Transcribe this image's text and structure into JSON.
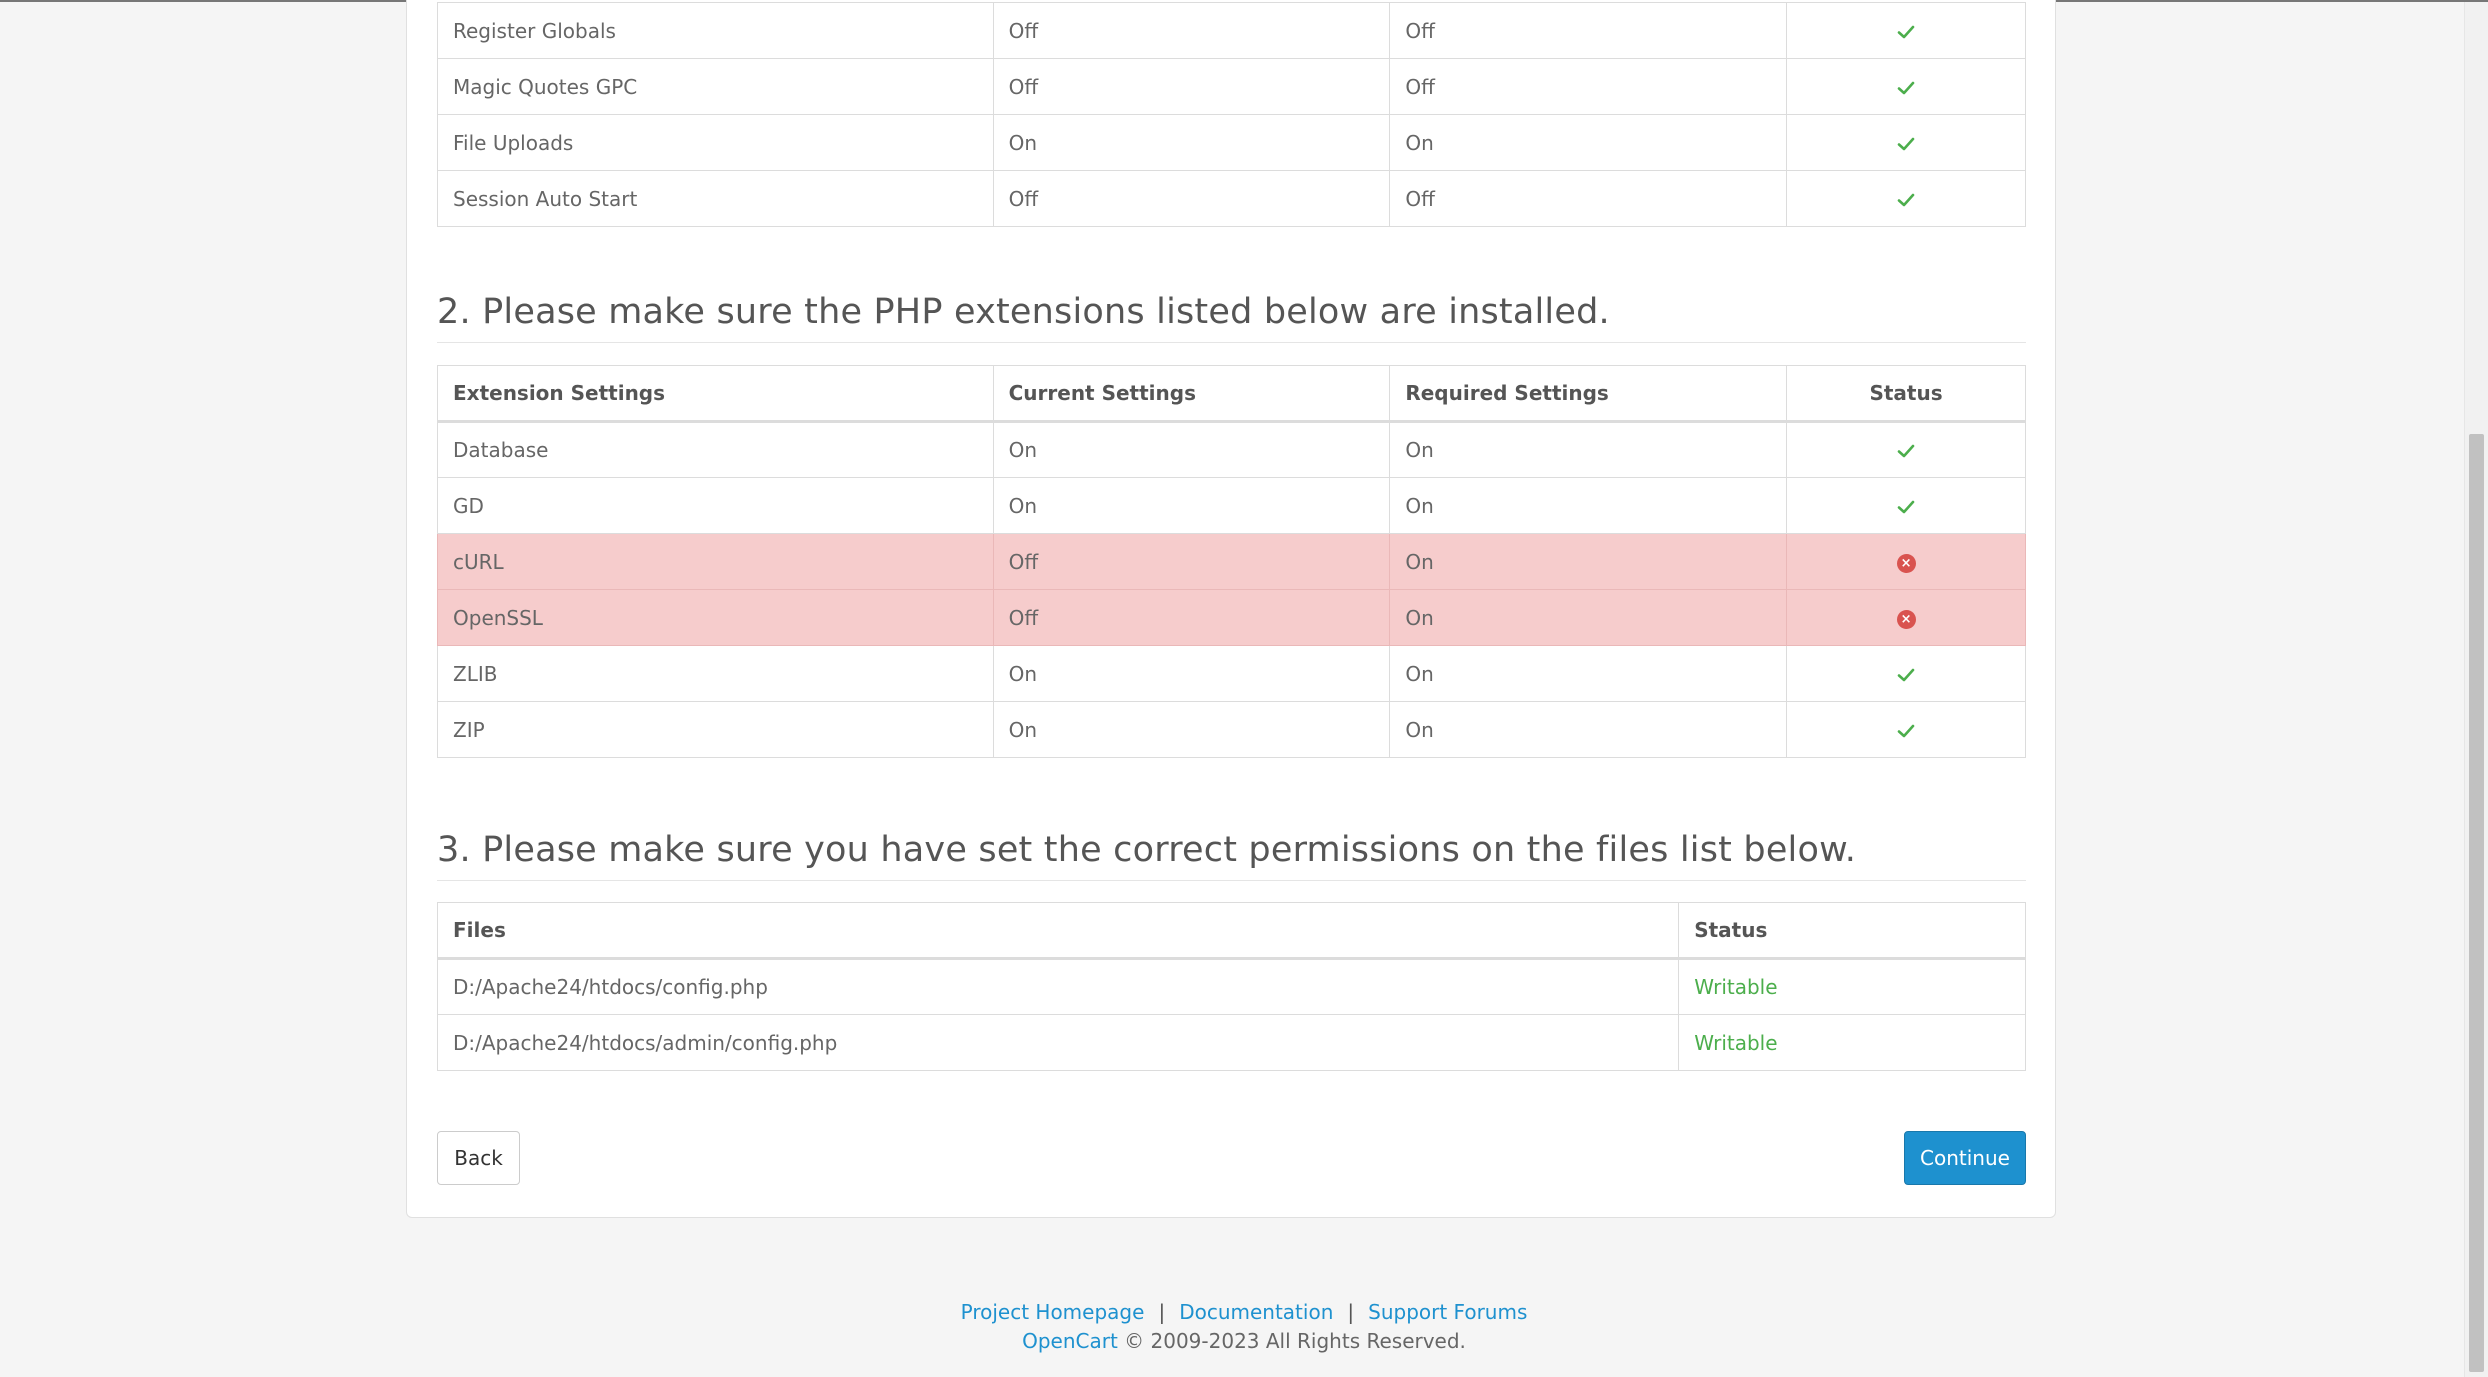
{
  "php_settings": {
    "rows": [
      {
        "name": "Register Globals",
        "current": "Off",
        "required": "Off",
        "status": "ok"
      },
      {
        "name": "Magic Quotes GPC",
        "current": "Off",
        "required": "Off",
        "status": "ok"
      },
      {
        "name": "File Uploads",
        "current": "On",
        "required": "On",
        "status": "ok"
      },
      {
        "name": "Session Auto Start",
        "current": "Off",
        "required": "Off",
        "status": "ok"
      }
    ]
  },
  "extensions": {
    "heading": "2. Please make sure the PHP extensions listed below are installed.",
    "columns": [
      "Extension Settings",
      "Current Settings",
      "Required Settings",
      "Status"
    ],
    "rows": [
      {
        "name": "Database",
        "current": "On",
        "required": "On",
        "status": "ok"
      },
      {
        "name": "GD",
        "current": "On",
        "required": "On",
        "status": "ok"
      },
      {
        "name": "cURL",
        "current": "Off",
        "required": "On",
        "status": "error"
      },
      {
        "name": "OpenSSL",
        "current": "Off",
        "required": "On",
        "status": "error"
      },
      {
        "name": "ZLIB",
        "current": "On",
        "required": "On",
        "status": "ok"
      },
      {
        "name": "ZIP",
        "current": "On",
        "required": "On",
        "status": "ok"
      }
    ]
  },
  "files": {
    "heading": "3. Please make sure you have set the correct permissions on the files list below.",
    "columns": [
      "Files",
      "Status"
    ],
    "rows": [
      {
        "path": "D:/Apache24/htdocs/config.php",
        "status": "Writable"
      },
      {
        "path": "D:/Apache24/htdocs/admin/config.php",
        "status": "Writable"
      }
    ]
  },
  "buttons": {
    "back": "Back",
    "continue": "Continue"
  },
  "footer": {
    "links": [
      "Project Homepage",
      "Documentation",
      "Support Forums"
    ],
    "separator": "|",
    "brand": "OpenCart",
    "copyright": "© 2009-2023 All Rights Reserved."
  },
  "colors": {
    "accent": "#1e91cf",
    "success": "#4cae4c",
    "danger_row": "#f6cccc",
    "danger_icon": "#d9534f"
  },
  "icons": {
    "ok": "check-icon",
    "error": "error-circle-icon"
  }
}
